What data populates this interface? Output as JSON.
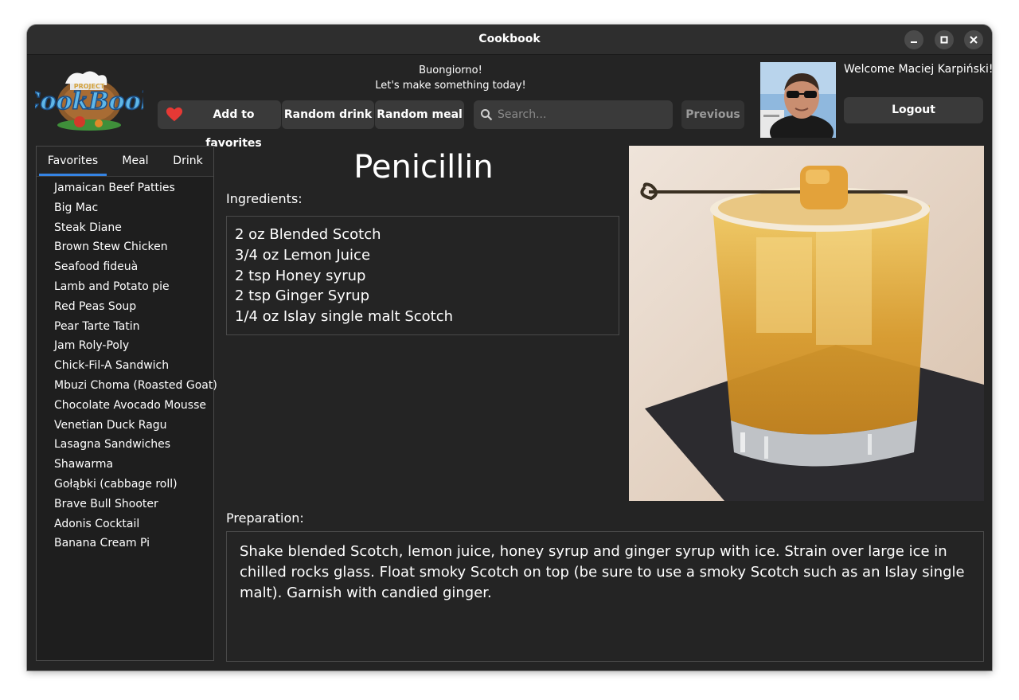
{
  "window": {
    "title": "Cookbook"
  },
  "header": {
    "greeting": "Buongiorno!",
    "subgreeting": "Let's make something today!",
    "add_favorites_label": "Add to favorites",
    "random_drink_label": "Random drink",
    "random_meal_label": "Random meal",
    "search_placeholder": "Search...",
    "previous_label": "Previous",
    "welcome_text": "Welcome Maciej Karpiński!",
    "logout_label": "Logout",
    "logo_text": [
      "PROJECT",
      "CookBook"
    ]
  },
  "sidebar": {
    "tabs": [
      {
        "label": "Favorites",
        "active": true
      },
      {
        "label": "Meal",
        "active": false
      },
      {
        "label": "Drink",
        "active": false
      }
    ],
    "items": [
      "Jamaican Beef Patties",
      "Big Mac",
      "Steak Diane",
      "Brown Stew Chicken",
      "Seafood fideuà",
      "Lamb and Potato pie",
      "Red Peas Soup",
      "Pear Tarte Tatin",
      "Jam Roly-Poly",
      "Chick-Fil-A Sandwich",
      "Mbuzi Choma (Roasted Goat)",
      "Chocolate Avocado Mousse",
      "Venetian Duck Ragu",
      "Lasagna Sandwiches",
      "Shawarma",
      "Gołąbki (cabbage roll)",
      "Brave Bull Shooter",
      "Adonis Cocktail",
      "Banana Cream Pi"
    ]
  },
  "drink": {
    "title": "Penicillin",
    "ingredients_label": "Ingredients:",
    "ingredients": [
      "2 oz Blended Scotch",
      "3/4 oz Lemon Juice",
      "2 tsp Honey syrup",
      "2 tsp Ginger Syrup",
      "1/4 oz Islay single malt Scotch"
    ],
    "preparation_label": "Preparation:",
    "preparation": "Shake blended Scotch, lemon juice, honey syrup and ginger syrup with ice. Strain over large ice in chilled rocks glass. Float smoky Scotch on top (be sure to use a smoky Scotch such as an Islay single malt). Garnish with candied ginger."
  },
  "colors": {
    "accent": "#3584e4",
    "background": "#242424",
    "button": "#3a3a3a",
    "heart": "#e53935"
  },
  "icons": {
    "favorite": "heart-icon",
    "search": "search-icon",
    "minimize": "minimize-icon",
    "maximize": "maximize-icon",
    "close": "close-icon"
  }
}
